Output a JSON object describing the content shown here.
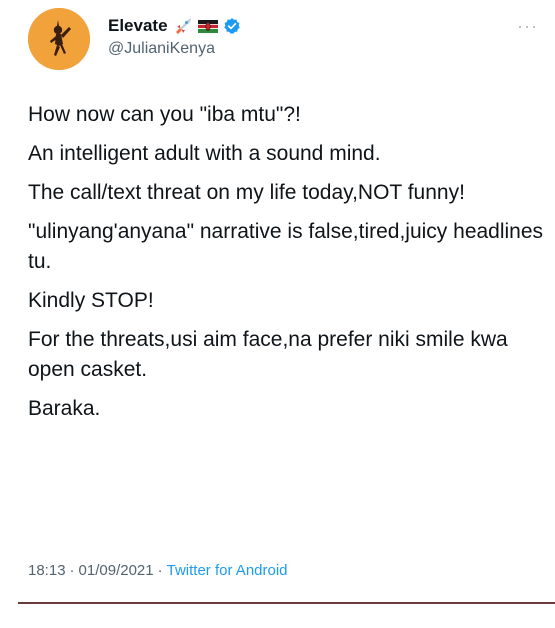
{
  "tweet": {
    "display_name": "Elevate",
    "handle": "@JulianiKenya",
    "more_label": "···",
    "lines": [
      "How now can you \"iba mtu\"?!",
      "An intelligent adult with a sound mind.",
      "The call/text threat on my life today,NOT funny!",
      "\"ulinyang'anyana\" narrative is false,tired,juicy headlines tu.",
      "Kindly STOP!",
      "For the threats,usi aim face,na prefer niki smile kwa open casket.",
      "Baraka."
    ],
    "time": "18:13",
    "separator": "·",
    "date": "01/09/2021",
    "source": "Twitter for Android"
  },
  "icons": {
    "avatar": "avatar-silhouette",
    "rocket": "rocket-emoji",
    "flag": "kenya-flag-emoji",
    "verified": "verified-badge-icon"
  },
  "colors": {
    "avatar_bg": "#f2a23a",
    "verified": "#1d9bf0",
    "link": "#1d9bf0",
    "muted": "#536471",
    "divider": "#6b3a3a"
  }
}
